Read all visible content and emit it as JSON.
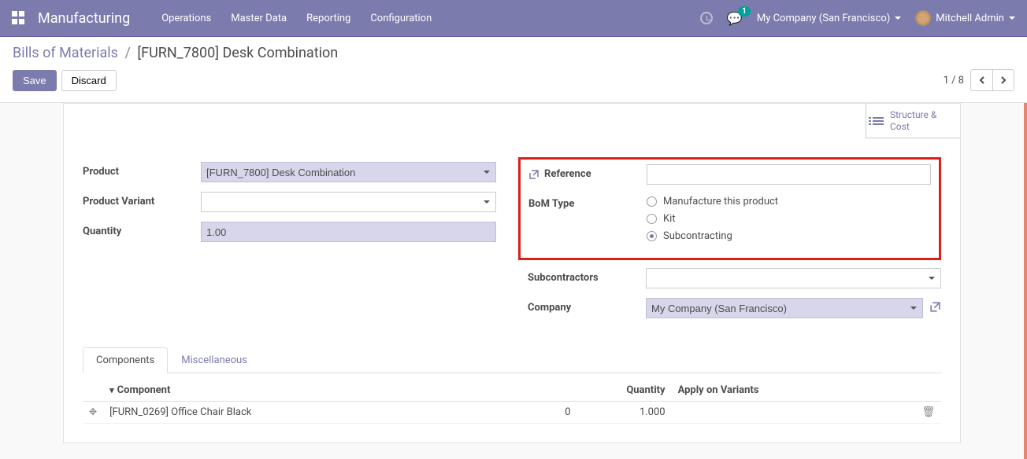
{
  "navbar": {
    "brand": "Manufacturing",
    "menu": [
      "Operations",
      "Master Data",
      "Reporting",
      "Configuration"
    ],
    "chat_badge": "1",
    "company": "My Company (San Francisco)",
    "user": "Mitchell Admin"
  },
  "breadcrumb": {
    "root": "Bills of Materials",
    "sep": "/",
    "current": "[FURN_7800] Desk Combination"
  },
  "buttons": {
    "save": "Save",
    "discard": "Discard"
  },
  "pager": {
    "text": "1 / 8"
  },
  "stat_button": {
    "line1": "Structure &",
    "line2": "Cost"
  },
  "form": {
    "labels": {
      "product": "Product",
      "variant": "Product Variant",
      "quantity": "Quantity",
      "reference": "Reference",
      "bom_type": "BoM Type",
      "subcontractors": "Subcontractors",
      "company": "Company"
    },
    "values": {
      "product": "[FURN_7800] Desk Combination",
      "variant": "",
      "quantity": "1.00",
      "reference": "",
      "company": "My Company (San Francisco)"
    },
    "bom_type_options": {
      "manufacture": "Manufacture this product",
      "kit": "Kit",
      "subcontract": "Subcontracting"
    }
  },
  "tabs": {
    "components": "Components",
    "misc": "Miscellaneous"
  },
  "table": {
    "headers": {
      "component": "Component",
      "quantity": "Quantity",
      "apply": "Apply on Variants"
    },
    "rows": [
      {
        "component": "[FURN_0269] Office Chair Black",
        "mid": "0",
        "quantity": "1.000",
        "apply": ""
      }
    ]
  }
}
